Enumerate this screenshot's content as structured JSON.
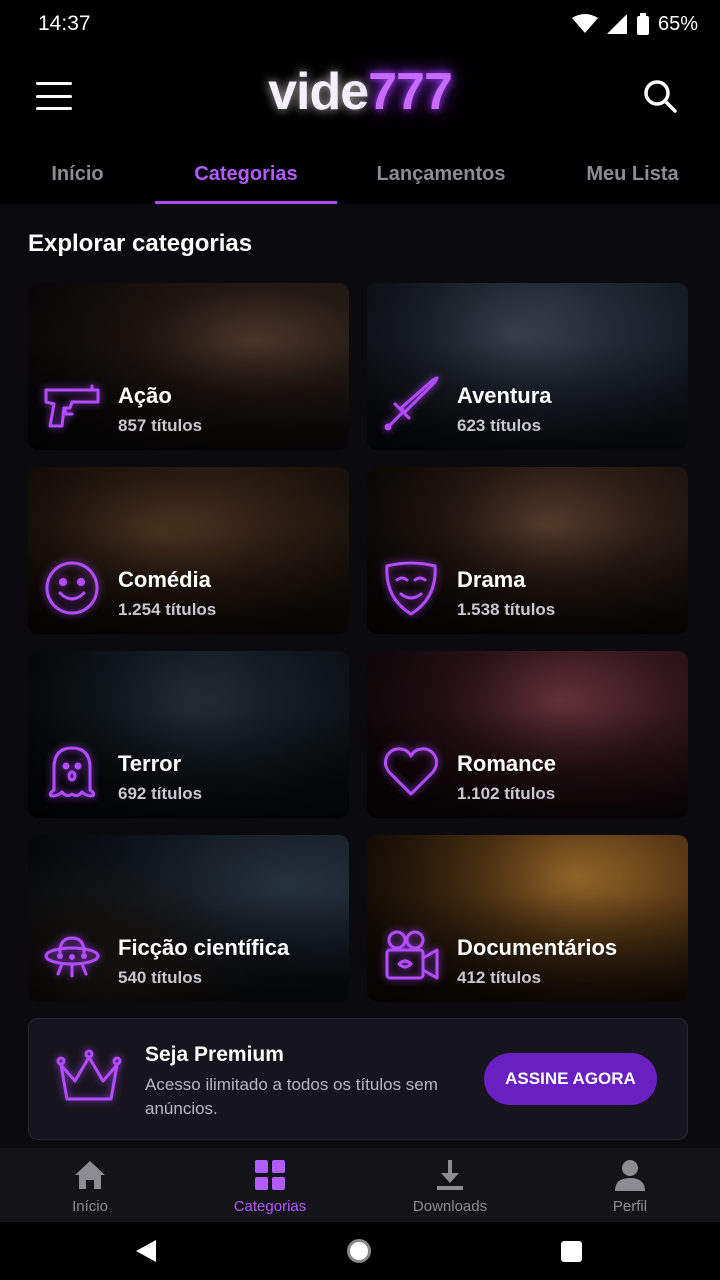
{
  "status": {
    "time": "14:37",
    "battery": "65%"
  },
  "app": {
    "logo_part1": "vide",
    "logo_part2": "777"
  },
  "tabs": [
    {
      "label": "Início"
    },
    {
      "label": "Categorias"
    },
    {
      "label": "Lançamentos"
    },
    {
      "label": "Meu Lista"
    }
  ],
  "section": {
    "title": "Explorar categorias"
  },
  "categories": [
    {
      "title": "Ação",
      "count": "857 títulos",
      "icon": "gun-icon"
    },
    {
      "title": "Aventura",
      "count": "623 títulos",
      "icon": "sword-icon"
    },
    {
      "title": "Comédia",
      "count": "1.254 títulos",
      "icon": "smiley-icon"
    },
    {
      "title": "Drama",
      "count": "1.538 títulos",
      "icon": "theater-mask-icon"
    },
    {
      "title": "Terror",
      "count": "692 títulos",
      "icon": "ghost-icon"
    },
    {
      "title": "Romance",
      "count": "1.102 títulos",
      "icon": "heart-icon"
    },
    {
      "title": "Ficção científica",
      "count": "540 títulos",
      "icon": "ufo-icon"
    },
    {
      "title": "Documentários",
      "count": "412 títulos",
      "icon": "camera-icon"
    }
  ],
  "premium": {
    "title": "Seja Premium",
    "description": "Acesso ilimitado a todos os títulos sem anúncios.",
    "button": "ASSINE AGORA"
  },
  "bottom_nav": [
    {
      "label": "Início",
      "icon": "home-icon"
    },
    {
      "label": "Categorias",
      "icon": "grid-icon"
    },
    {
      "label": "Downloads",
      "icon": "download-icon"
    },
    {
      "label": "Perfil",
      "icon": "person-icon"
    }
  ],
  "colors": {
    "accent": "#b15cff",
    "button": "#6a1fc0",
    "background": "#0b0a0f"
  }
}
